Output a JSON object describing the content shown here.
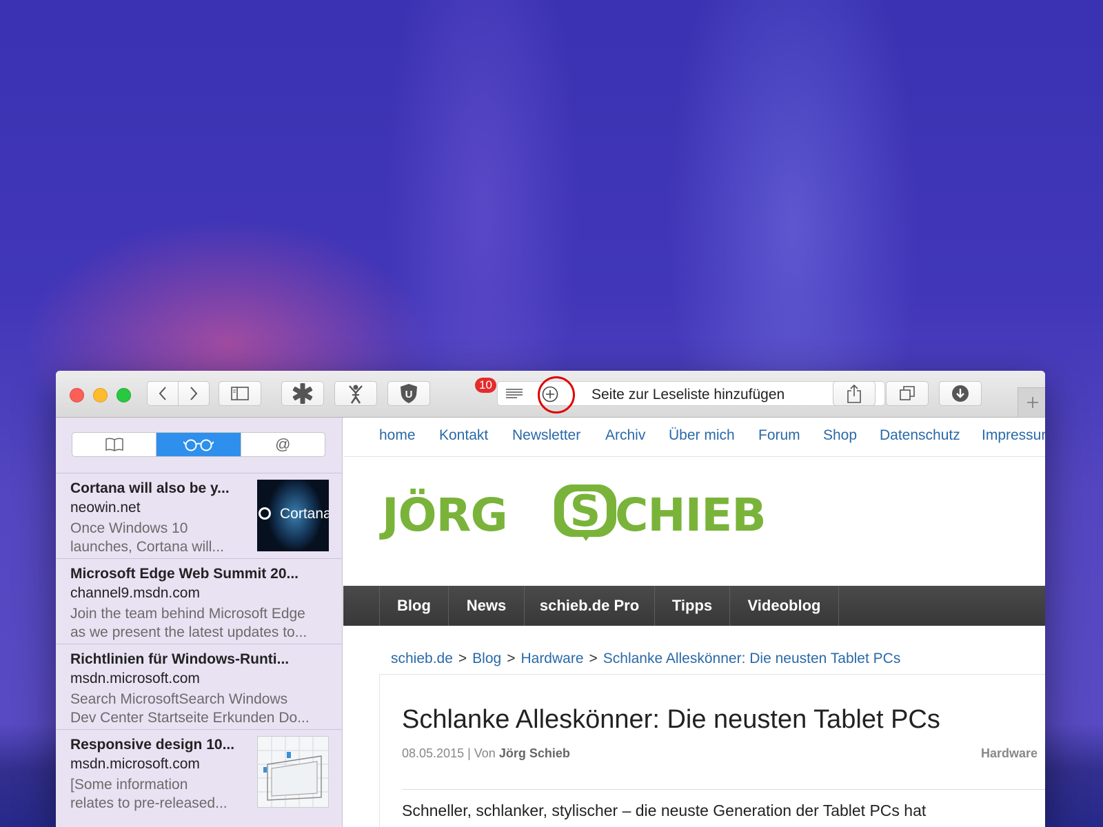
{
  "toolbar": {
    "badge_count": "10",
    "address_text": "Seite zur Leseliste hinzufügen"
  },
  "sidebar": {
    "reading_list": [
      {
        "title": "Cortana will also be y...",
        "domain": "neowin.net",
        "snippet1": "Once Windows 10",
        "snippet2": "launches, Cortana will...",
        "thumb_text": "Cortana"
      },
      {
        "title": "Microsoft Edge Web Summit 20...",
        "domain": "channel9.msdn.com",
        "snippet1": "Join the team behind Microsoft Edge",
        "snippet2": "as we present the latest updates to..."
      },
      {
        "title": "Richtlinien für Windows-Runti...",
        "domain": "msdn.microsoft.com",
        "snippet1": "Search MicrosoftSearch Windows",
        "snippet2": "Dev Center Startseite Erkunden Do..."
      },
      {
        "title": "Responsive design 10...",
        "domain": "msdn.microsoft.com",
        "snippet1": "[Some information",
        "snippet2": "relates to pre-released..."
      }
    ]
  },
  "site": {
    "top_nav": [
      "home",
      "Kontakt",
      "Newsletter",
      "Archiv",
      "Über mich",
      "Forum",
      "Shop",
      "Datenschutz",
      "Impressum"
    ],
    "logo_left": "JÖRG",
    "logo_s": "S",
    "logo_right": "CHIEB",
    "main_nav": [
      "Blog",
      "News",
      "schieb.de Pro",
      "Tipps",
      "Videoblog"
    ],
    "breadcrumb": [
      "schieb.de",
      "Blog",
      "Hardware",
      "Schlanke Alleskönner: Die neusten Tablet PCs"
    ],
    "breadcrumb_sep": ">",
    "article": {
      "title": "Schlanke Alleskönner: Die neusten Tablet PCs",
      "date": "08.05.2015",
      "meta_sep": " | Von ",
      "author": "Jörg Schieb",
      "category": "Hardware",
      "body": "Schneller, schlanker, stylischer – die neuste Generation der Tablet PCs hat"
    }
  },
  "colors": {
    "accent_blue": "#2e90ec",
    "link_blue": "#2a69a8",
    "logo_green": "#7ab33a",
    "badge_red": "#e52b2b",
    "highlight_red": "#e00000"
  }
}
